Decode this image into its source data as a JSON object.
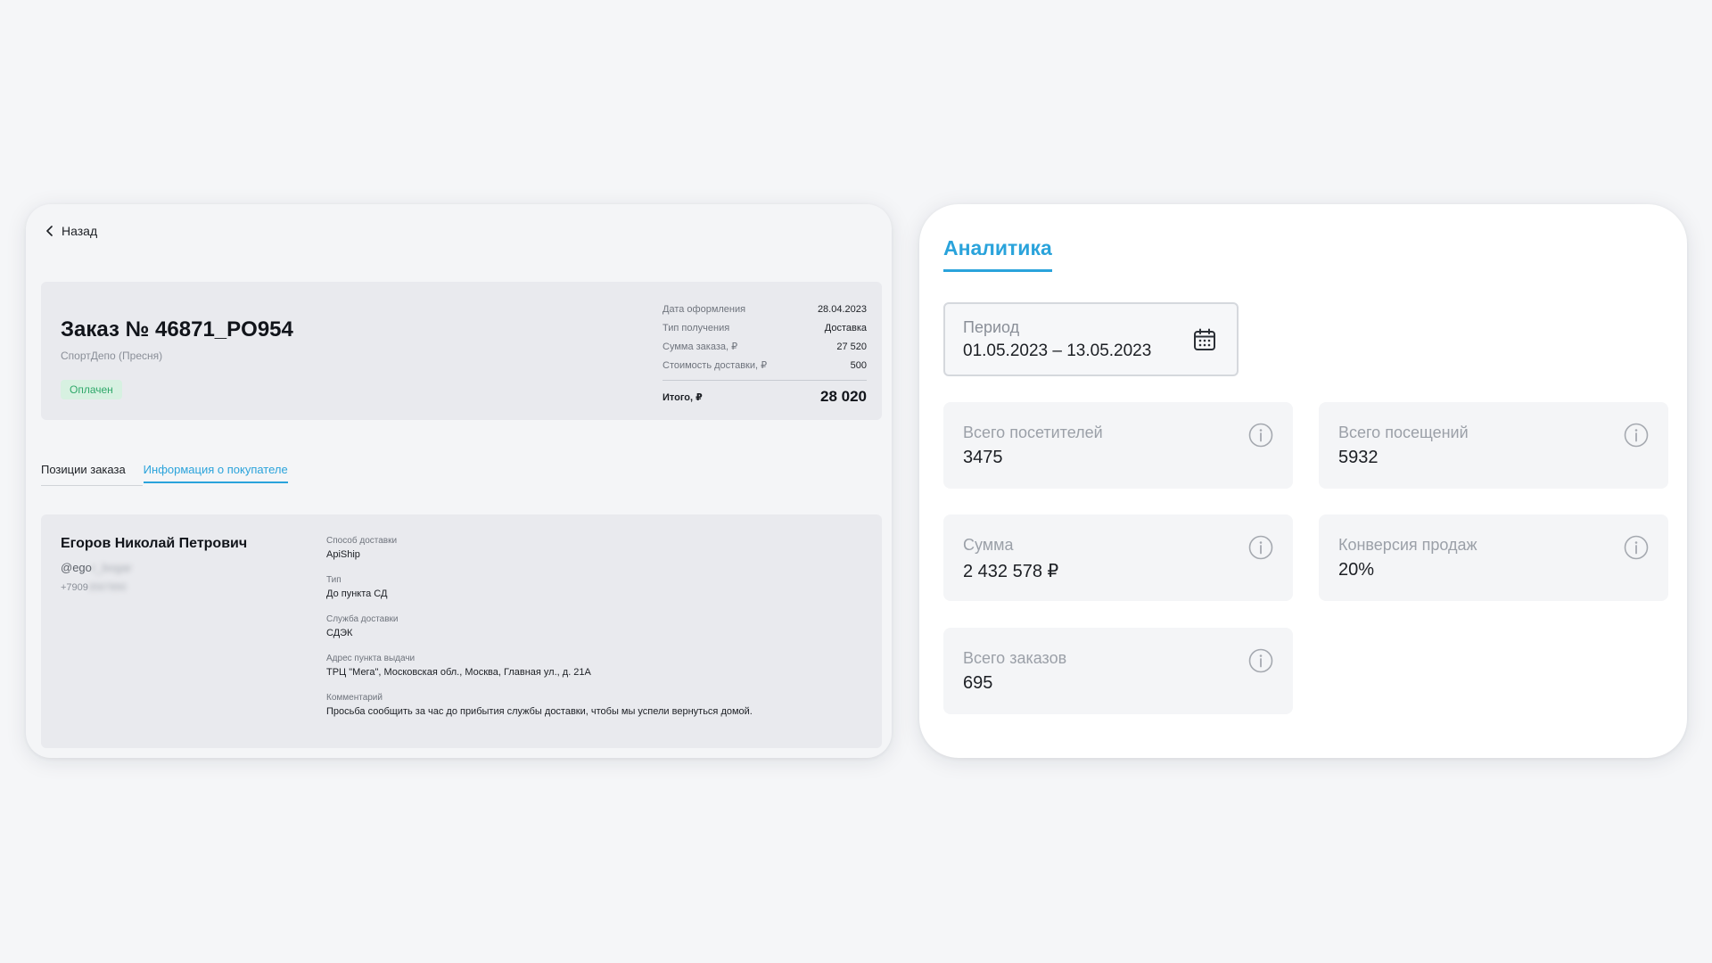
{
  "order": {
    "back_label": "Назад",
    "title": "Заказ № 46871_PO954",
    "shop": "СпортДепо (Пресня)",
    "status": "Оплачен",
    "meta": [
      {
        "label": "Дата оформления",
        "value": "28.04.2023"
      },
      {
        "label": "Тип получения",
        "value": "Доставка"
      },
      {
        "label": "Сумма заказа, ₽",
        "value": "27 520"
      },
      {
        "label": "Стоимость доставки, ₽",
        "value": "500"
      }
    ],
    "total_label": "Итого, ₽",
    "total_value": "28 020",
    "tabs": [
      {
        "label": "Позиции заказа",
        "active": false
      },
      {
        "label": "Информация о покупателе",
        "active": true
      }
    ],
    "customer": {
      "name": "Егоров Николай Петрович",
      "login_visible": "@ego",
      "login_hidden": "r_bogar",
      "phone_visible": "+7909",
      "phone_hidden": "3567890"
    },
    "details": [
      {
        "label": "Способ доставки",
        "value": "ApiShip"
      },
      {
        "label": "Тип",
        "value": "До пункта СД"
      },
      {
        "label": "Служба доставки",
        "value": "СДЭК"
      },
      {
        "label": "Адрес пункта выдачи",
        "value": "ТРЦ \"Мега\", Московская обл., Москва, Главная ул., д. 21А"
      },
      {
        "label": "Комментарий",
        "value": "Просьба сообщить за час до прибытия службы доставки, чтобы мы успели вернуться домой."
      }
    ]
  },
  "analytics": {
    "title": "Аналитика",
    "period_label": "Период",
    "period_value": "01.05.2023 – 13.05.2023",
    "stats": [
      {
        "label": "Всего посетителей",
        "value": "3475"
      },
      {
        "label": "Всего посещений",
        "value": "5932"
      },
      {
        "label": "Сумма",
        "value": "2 432 578 ₽"
      },
      {
        "label": "Конверсия продаж",
        "value": "20%"
      },
      {
        "label": "Всего заказов",
        "value": "695"
      }
    ]
  },
  "colors": {
    "accent": "#2aa3db",
    "status_bg": "#d7f1e1",
    "status_text": "#2fa86a"
  },
  "icons": [
    "chevron-left-icon",
    "calendar-icon",
    "info-icon"
  ]
}
